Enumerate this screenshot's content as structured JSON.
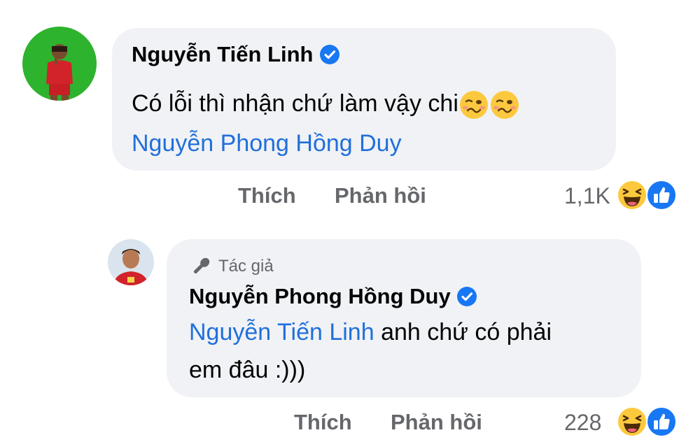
{
  "comment": {
    "author": "Nguyễn Tiến Linh",
    "text": "Có lỗi thì nhận chứ làm vậy chi",
    "emojis": [
      "woozy-face-emoji",
      "woozy-face-emoji"
    ],
    "mention": "Nguyễn Phong Hồng Duy",
    "like_label": "Thích",
    "reply_label": "Phản hồi",
    "reaction_count": "1,1K",
    "reactions": [
      "haha",
      "like"
    ]
  },
  "reply": {
    "badge": "Tác giả",
    "author": "Nguyễn Phong Hồng Duy",
    "mention": "Nguyễn Tiến Linh",
    "text_line1": " anh chứ có phải",
    "text_line2": "em đâu :)))",
    "like_label": "Thích",
    "reply_label": "Phản hồi",
    "reaction_count": "228",
    "reactions": [
      "haha",
      "like"
    ]
  },
  "colors": {
    "bubble": "#f0f2f5",
    "link": "#216fdb",
    "verified": "#1877f2",
    "secondary_text": "#65676b"
  }
}
